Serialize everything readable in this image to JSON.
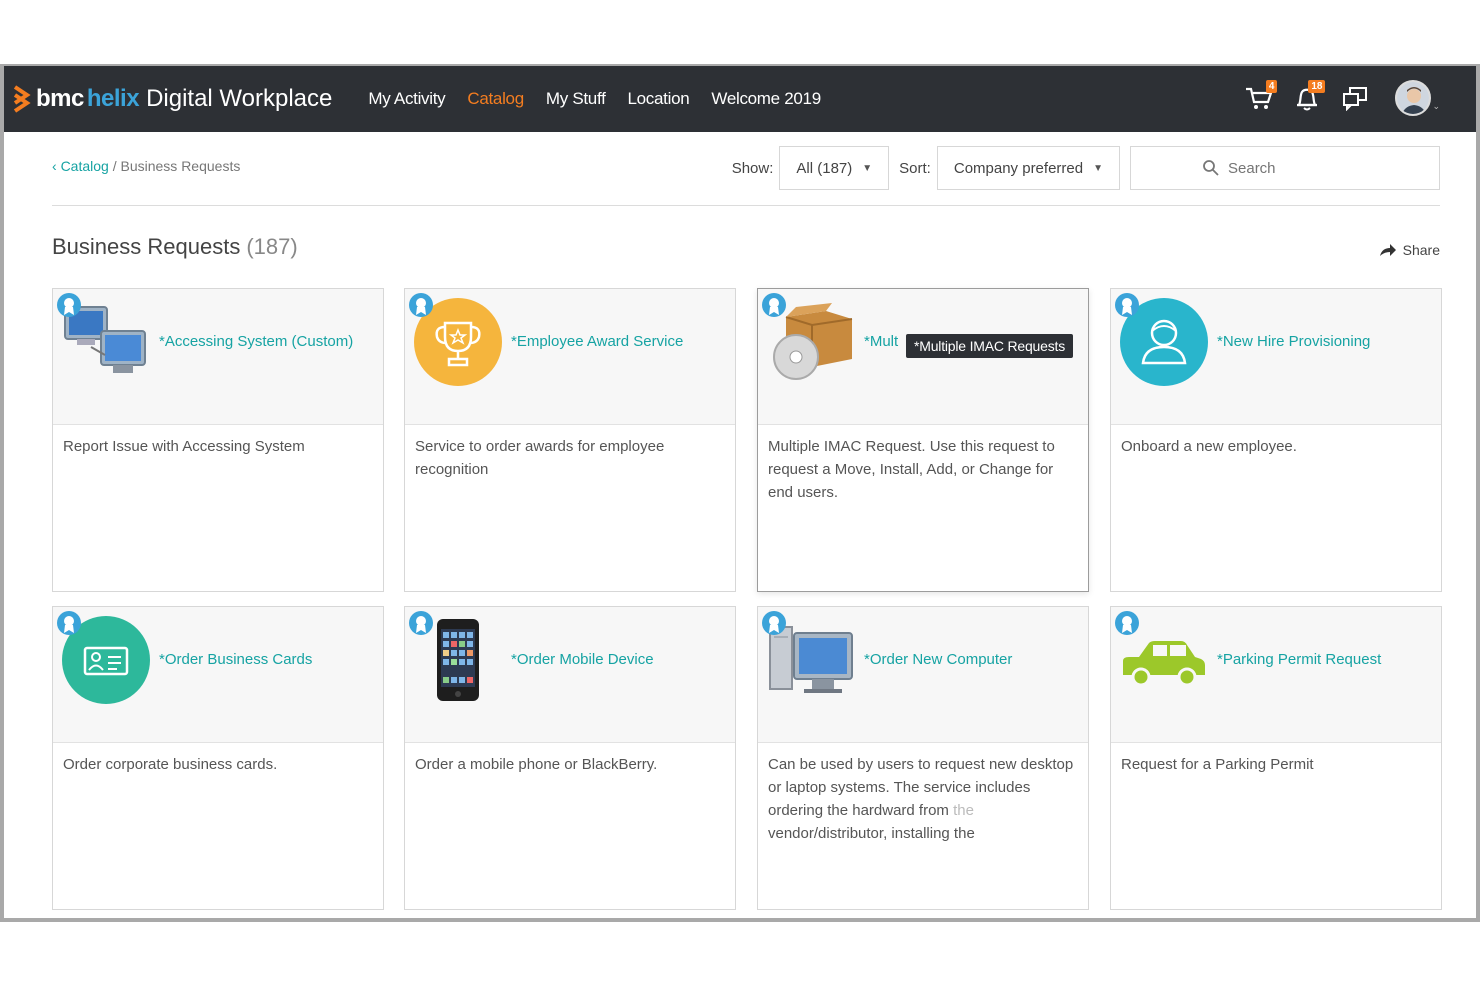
{
  "app": {
    "brand_bmc": "bmc",
    "brand_helix": "helix",
    "brand_product": "Digital Workplace",
    "accent_color": "#f47d20",
    "teal_color": "#16a3a3"
  },
  "nav": [
    {
      "label": "My Activity",
      "active": false
    },
    {
      "label": "Catalog",
      "active": true
    },
    {
      "label": "My Stuff",
      "active": false
    },
    {
      "label": "Location",
      "active": false
    },
    {
      "label": "Welcome 2019",
      "active": false
    }
  ],
  "top_icons": {
    "cart_icon": "cart-icon",
    "cart_count": "4",
    "bell_icon": "bell-icon",
    "notification_count": "18",
    "chat_icon": "chat-icon",
    "avatar_icon": "user-avatar"
  },
  "breadcrumb": {
    "parent": "Catalog",
    "separator": "/",
    "current": "Business Requests"
  },
  "filters": {
    "show_label": "Show:",
    "show_value": "All (187)",
    "sort_label": "Sort:",
    "sort_value": "Company preferred",
    "search_placeholder": "Search"
  },
  "page": {
    "title": "Business Requests",
    "count": "(187)",
    "share_label": "Share"
  },
  "cards": [
    {
      "title": "*Accessing System (Custom)",
      "description": "Report Issue with Accessing System",
      "icon": "computers-icon"
    },
    {
      "title": "*Employee Award Service",
      "description": "Service to order awards for employee recognition",
      "icon": "trophy-icon"
    },
    {
      "title": "*Mult",
      "description": "Multiple IMAC Request. Use this request to request a Move, Install, Add, or Change for end users.",
      "icon": "software-box-icon",
      "tooltip": "*Multiple IMAC Requests"
    },
    {
      "title": "*New Hire Provisioning",
      "description": "Onboard a new employee.",
      "icon": "person-icon"
    },
    {
      "title": "*Order Business Cards",
      "description": "Order corporate business cards.",
      "icon": "id-card-icon"
    },
    {
      "title": "*Order Mobile Device",
      "description": "Order a mobile phone or BlackBerry.",
      "icon": "smartphone-icon"
    },
    {
      "title": "*Order New Computer",
      "description_main": "Can be used by users to request new desktop or laptop systems. The service includes ordering the hardward from",
      "description_faded": "the",
      "description_tail": "vendor/distributor, installing the",
      "icon": "desktop-computer-icon"
    },
    {
      "title": "*Parking Permit Request",
      "description": "Request for a Parking Permit",
      "icon": "car-icon"
    }
  ]
}
